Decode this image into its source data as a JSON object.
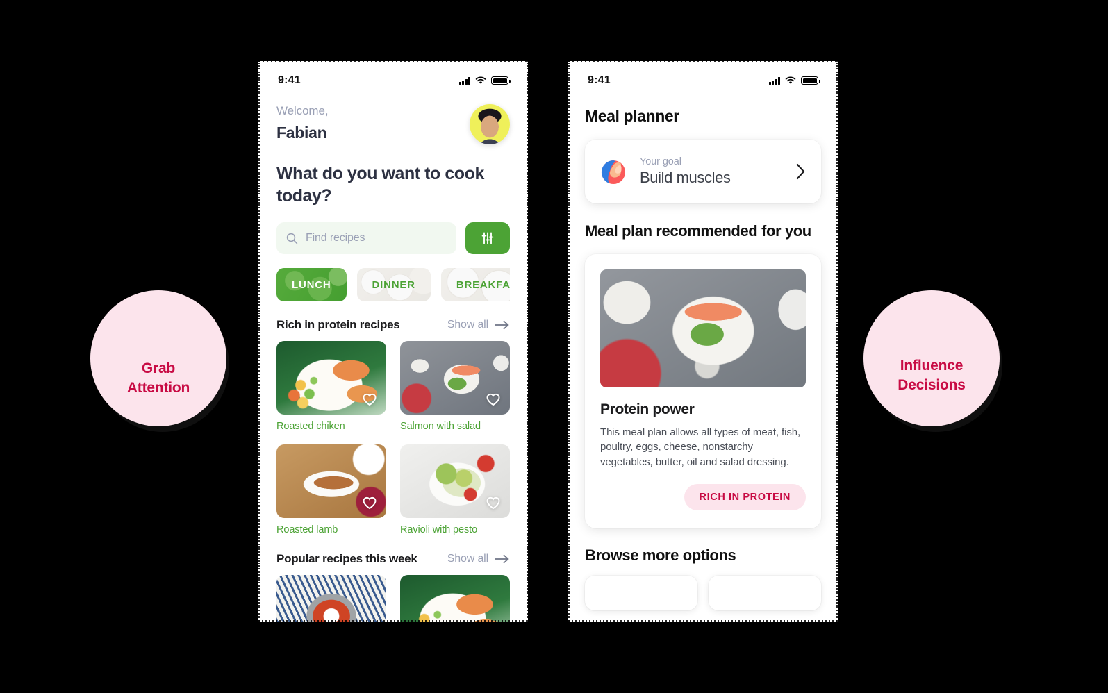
{
  "badges": [
    {
      "name": "grab-attention",
      "text": "Grab\nAttention"
    },
    {
      "name": "influence-decisions",
      "text": "Influence\nDecisions"
    }
  ],
  "accent": {
    "green": "#4CA335",
    "pink_bg": "#FCE4EC",
    "crimson": "#C80B44",
    "muted": "#9AA0B5"
  },
  "phone1": {
    "status": {
      "time": "9:41",
      "signal": "cellular-signal-icon",
      "wifi": "wifi-icon",
      "battery": "battery-full-icon"
    },
    "welcome_label": "Welcome,",
    "user_name": "Fabian",
    "avatar": "user-avatar",
    "headline": "What do you want to cook today?",
    "search": {
      "placeholder": "Find recipes",
      "value": "",
      "icon": "search-icon"
    },
    "filter_button": {
      "icon": "sliders-filter-icon"
    },
    "tabs": [
      {
        "label": "LUNCH",
        "active": true
      },
      {
        "label": "DINNER",
        "active": false
      },
      {
        "label": "BREAKFAST",
        "active": false
      }
    ],
    "sections": [
      {
        "title": "Rich in protein recipes",
        "show_all": "Show all",
        "show_all_icon": "arrow-right-icon",
        "cards": [
          {
            "name": "Roasted chiken",
            "photo": "f-chicken",
            "fav_icon": "heart-outline-icon"
          },
          {
            "name": "Salmon with salad",
            "photo": "f-salmon",
            "fav_icon": "heart-outline-icon"
          },
          {
            "name": "Roasted lamb",
            "photo": "f-lamb",
            "fav_icon": "heart-outline-icon"
          },
          {
            "name": "Ravioli with pesto",
            "photo": "f-ravioli",
            "fav_icon": "heart-outline-icon"
          }
        ]
      },
      {
        "title": "Popular recipes this week",
        "show_all": "Show all",
        "show_all_icon": "arrow-right-icon",
        "cards": [
          {
            "name": "",
            "photo": "f-soup",
            "fav_icon": "heart-outline-icon"
          },
          {
            "name": "",
            "photo": "f-chicken",
            "fav_icon": "heart-outline-icon"
          }
        ]
      }
    ]
  },
  "phone2": {
    "status": {
      "time": "9:41",
      "signal": "cellular-signal-icon",
      "wifi": "wifi-icon",
      "battery": "battery-full-icon"
    },
    "title": "Meal planner",
    "goal_card": {
      "icon": "flexed-bicep-icon",
      "label": "Your goal",
      "value": "Build muscles",
      "chevron": "chevron-right-icon"
    },
    "recommend_heading": "Meal plan recommended for you",
    "plan": {
      "image": "salmon-salad-photo",
      "title": "Protein power",
      "description": "This meal plan allows all types of meat, fish, poultry, eggs, cheese, nonstarchy vegetables, butter, oil and salad dressing.",
      "tag": "RICH IN PROTEIN"
    },
    "browse_heading": "Browse more options"
  }
}
